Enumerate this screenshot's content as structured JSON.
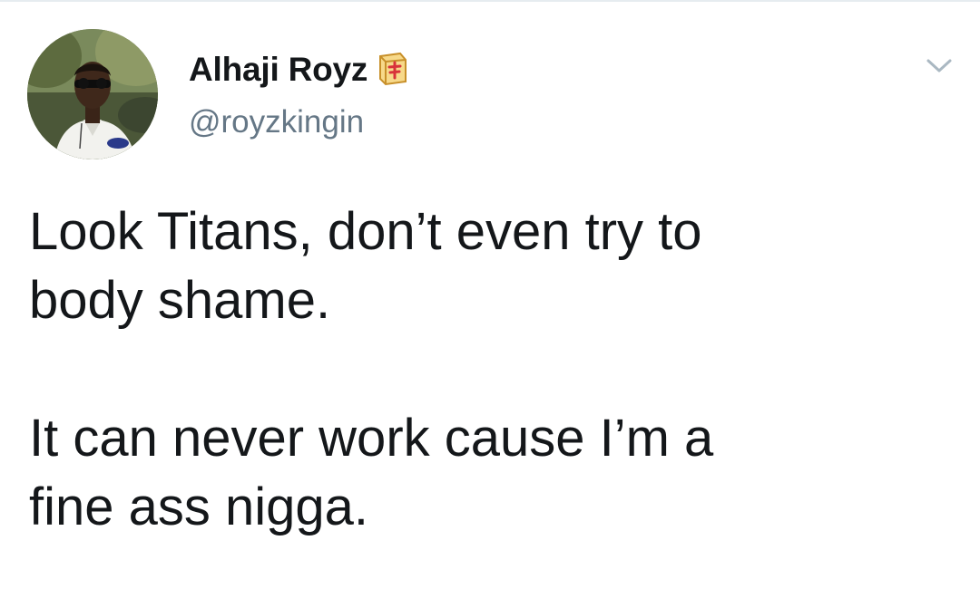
{
  "tweet": {
    "author": {
      "display_name": "Alhaji Royz",
      "handle": "@royzkingin",
      "badge_icon": "mahjong-tile-icon",
      "avatar": "profile-photo"
    },
    "menu_icon": "chevron-down-icon",
    "paragraphs": [
      "Look Titans, don’t even try to\nbody shame.",
      "It can never work cause I’m a\nfine ass nigga."
    ]
  },
  "colors": {
    "text": "#14171a",
    "secondary_text": "#657786",
    "divider": "#e6ecf0",
    "chevron": "#aab8c2",
    "badge_gold": "#e8b64a",
    "badge_red": "#d8323a"
  }
}
